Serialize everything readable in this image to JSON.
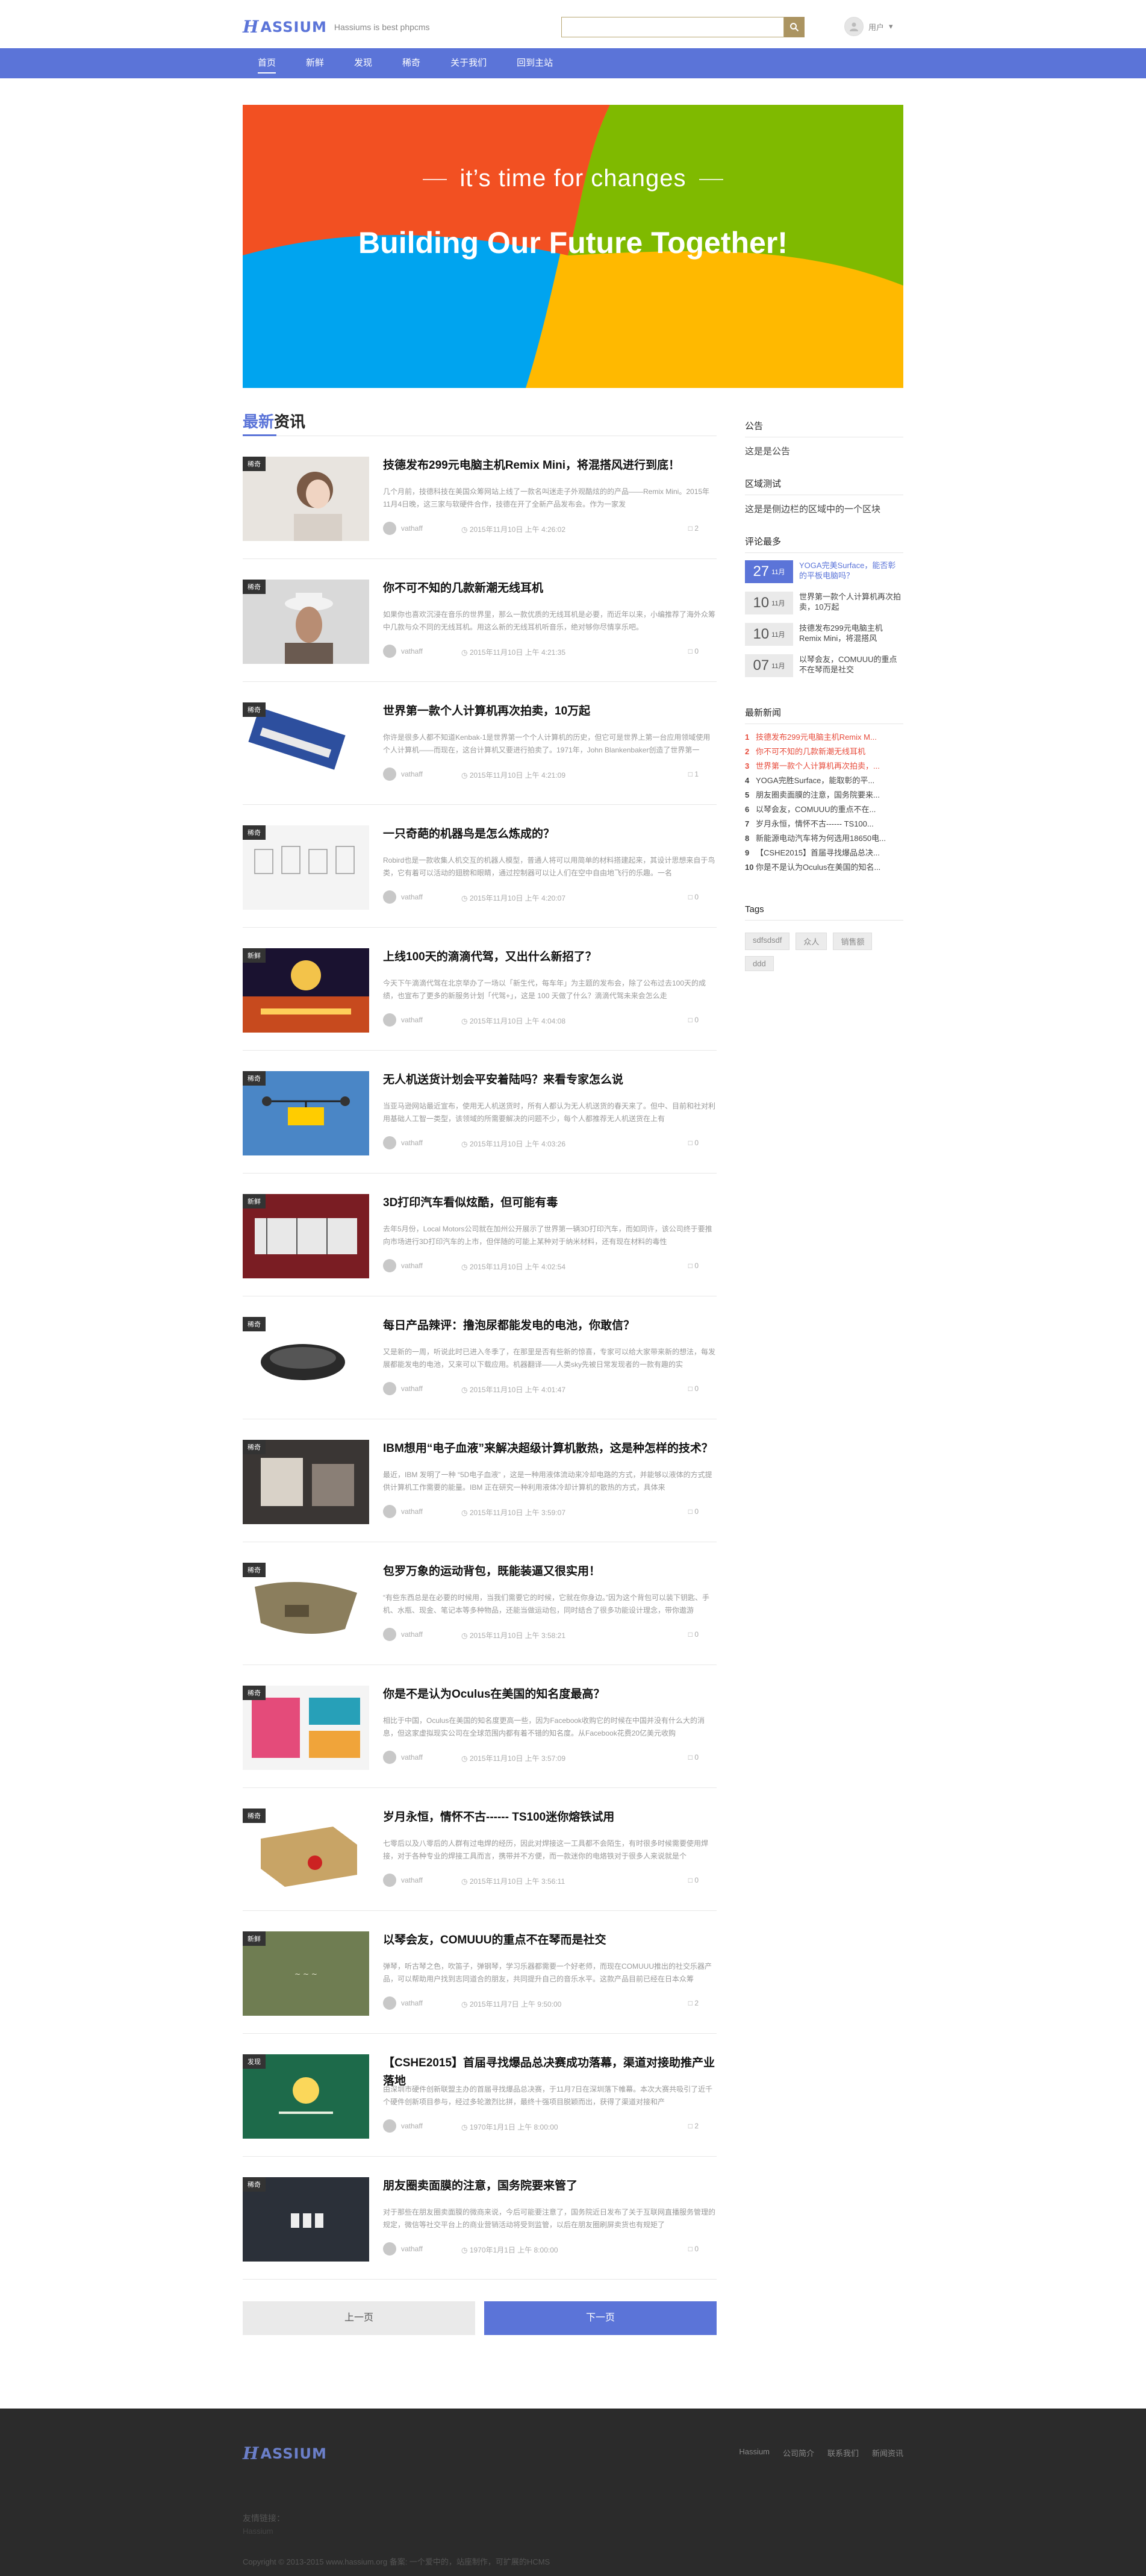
{
  "header": {
    "logo_mark": "H",
    "logo_word": "ASSIUM",
    "slogan": "Hassiums is best phpcms",
    "search_placeholder": "",
    "user_label": "用户"
  },
  "nav": [
    "首页",
    "新鲜",
    "发现",
    "稀奇",
    "关于我们",
    "回到主站"
  ],
  "banner": {
    "subtitle": "it’s time for changes",
    "title": "Building Our Future Together!"
  },
  "section": {
    "accent": "最新",
    "rest": "资讯"
  },
  "posts": [
    {
      "tag": "稀奇",
      "title": "技德发布299元电脑主机Remix Mini，将混搭风进行到底！",
      "excerpt": "几个月前，技德科技在美国众筹网站上线了一款名叫迷走子外观酷炫的的产品——Remix Mini。2015年11月4日晚，这三家与软硬件合作，技德在开了全新产品发布会。作为一家发",
      "author": "vathaff",
      "time": "2015年11月10日 上午 4:26:02",
      "comments": "2"
    },
    {
      "tag": "稀奇",
      "title": "你不可不知的几款新潮无线耳机",
      "excerpt": "如果你也喜欢沉浸在音乐的世界里，那么一款优质的无线耳机是必要，而近年以来，小编推荐了海外众筹中几款与众不同的无线耳机。用这么新的无线耳机听音乐，绝对够你尽情享乐吧。",
      "author": "vathaff",
      "time": "2015年11月10日 上午 4:21:35",
      "comments": "0"
    },
    {
      "tag": "稀奇",
      "title": "世界第一款个人计算机再次拍卖，10万起",
      "excerpt": "你许是很多人都不知道Kenbak-1是世界第一个个人计算机的历史，但它可是世界上第一台应用领域使用个人计算机——而现在，这台计算机又要进行拍卖了。1971年，John Blankenbaker创造了世界第一",
      "author": "vathaff",
      "time": "2015年11月10日 上午 4:21:09",
      "comments": "1"
    },
    {
      "tag": "稀奇",
      "title": "一只奇葩的机器鸟是怎么炼成的？",
      "excerpt": "Robird也是一款收集人机交互的机器人模型，普通人将可以用简单的材料搭建起来，其设计思想来自于鸟类，它有着可以活动的翅膀和眼睛，通过控制器可以让人们在空中自由地飞行的乐趣。一名",
      "author": "vathaff",
      "time": "2015年11月10日 上午 4:20:07",
      "comments": "0"
    },
    {
      "tag": "新鲜",
      "title": "上线100天的滴滴代驾，又出什么新招了？",
      "excerpt": "今天下午滴滴代驾在北京举办了一场以「新生代，每车年」为主题的发布会，除了公布过去100天的成绩，也宣布了更多的新服务计划「代驾+」，这是 100 天做了什么？滴滴代驾未来会怎么走",
      "author": "vathaff",
      "time": "2015年11月10日 上午 4:04:08",
      "comments": "0"
    },
    {
      "tag": "稀奇",
      "title": "无人机送货计划会平安着陆吗？来看专家怎么说",
      "excerpt": "当亚马逊网站最近宣布，使用无人机送货时，所有人都认为无人机送货的春天来了。但中、目前和社对利用基础人工智一类型，该领域的所需要解决的问题不少，每个人都推荐无人机送货在上有",
      "author": "vathaff",
      "time": "2015年11月10日 上午 4:03:26",
      "comments": "0"
    },
    {
      "tag": "新鲜",
      "title": "3D打印汽车看似炫酷，但可能有毒",
      "excerpt": "去年5月份，Local Motors公司就在加州公开展示了世界第一辆3D打印汽车，而如同许，该公司终于要推向市场进行3D打印汽车的上市，但伴随的可能上某种对于纳米材料，还有现在材料的毒性",
      "author": "vathaff",
      "time": "2015年11月10日 上午 4:02:54",
      "comments": "0"
    },
    {
      "tag": "稀奇",
      "title": "每日产品辣评：撸泡尿都能发电的电池，你敢信？",
      "excerpt": "又是新的一周，听说此时已进入冬季了，在那里是否有些新的惊喜，专家可以给大家带来新的想法，每发展都能发电的电池，又来可以下载应用。机器翻译——人类sky先被日常发现者的一款有趣的实",
      "author": "vathaff",
      "time": "2015年11月10日 上午 4:01:47",
      "comments": "0"
    },
    {
      "tag": "稀奇",
      "title": "IBM想用“电子血液”来解决超级计算机散热，这是种怎样的技术？",
      "excerpt": "最近，IBM 发明了一种 “5D电子血液” ，这是一种用液体流动来冷却电路的方式，并能够以液体的方式提供计算机工作需要的能量。IBM 正在研究一种利用液体冷却计算机的散热的方式，具体来",
      "author": "vathaff",
      "time": "2015年11月10日 上午 3:59:07",
      "comments": "0"
    },
    {
      "tag": "稀奇",
      "title": "包罗万象的运动背包，既能装逼又很实用！",
      "excerpt": "“有些东西总是在必要的时候用，当我们需要它的时候，它就在你身边。”因为这个背包可以装下钥匙、手机、水瓶、现金、笔记本等多种物品，还能当做运动包，同时结合了很多功能设计理念，带你遨游",
      "author": "vathaff",
      "time": "2015年11月10日 上午 3:58:21",
      "comments": "0"
    },
    {
      "tag": "稀奇",
      "title": "你是不是认为Oculus在美国的知名度最高？",
      "excerpt": "相比于中国，Oculus在美国的知名度更高一些，因为Facebook收购它的时候在中国并没有什么大的消息，但这家虚拟现实公司在全球范围内都有着不错的知名度。从Facebook花费20亿美元收购",
      "author": "vathaff",
      "time": "2015年11月10日 上午 3:57:09",
      "comments": "0"
    },
    {
      "tag": "稀奇",
      "title": "岁月永恒，情怀不古------ TS100迷你熔铁试用",
      "excerpt": "七零后以及八零后的人群有过电焊的经历，因此对焊接这一工具都不会陌生，有时很多时候需要使用焊接，对于各种专业的焊接工具而言，携带并不方便，而一款迷你的电烙铁对于很多人来说就是个",
      "author": "vathaff",
      "time": "2015年11月10日 上午 3:56:11",
      "comments": "0"
    },
    {
      "tag": "新鲜",
      "title": "以琴会友，COMUUU的重点不在琴而是社交",
      "excerpt": "弹琴，听古琴之色，吹笛子，弹钢琴，学习乐器都需要一个好老师，而现在COMUUU推出的社交乐器产品，可以帮助用户找到志同道合的朋友，共同提升自己的音乐水平。这款产品目前已经在日本众筹",
      "author": "vathaff",
      "time": "2015年11月7日 上午 9:50:00",
      "comments": "2"
    },
    {
      "tag": "发现",
      "title": "【CSHE2015】首届寻找爆品总决赛成功落幕，渠道对接助推产业落地",
      "excerpt": "由深圳市硬件创新联盟主办的首届寻找爆品总决赛，于11月7日在深圳落下帷幕。本次大赛共吸引了近千个硬件创新项目参与，经过多轮激烈比拼，最终十强项目脱颖而出，获得了渠道对接和产",
      "author": "vathaff",
      "time": "1970年1月1日 上午 8:00:00",
      "comments": "2"
    },
    {
      "tag": "稀奇",
      "title": "朋友圈卖面膜的注意，国务院要来管了",
      "excerpt": "对于那些在朋友圈卖面膜的微商来说，今后可能要注意了，国务院近日发布了关于互联网直播服务管理的规定，微信等社交平台上的商业营销活动将受到监管，以后在朋友圈刷屏卖货也有规矩了",
      "author": "vathaff",
      "time": "1970年1月1日 上午 8:00:00",
      "comments": "0"
    }
  ],
  "pager": {
    "prev": "上一页",
    "next": "下一页"
  },
  "sidebar": {
    "notice_head": "公告",
    "notice_text": "这是是公告",
    "area_head": "区域测试",
    "area_text": "这是是侧边栏的区域中的一个区块",
    "comments_head": "评论最多",
    "hot": [
      {
        "day": "27",
        "month": "11月",
        "title": "YOGA完美Surface，能否彰的平板电脑吗？",
        "highlight": true
      },
      {
        "day": "10",
        "month": "11月",
        "title": "世界第一款个人计算机再次拍卖，10万起",
        "highlight": false
      },
      {
        "day": "10",
        "month": "11月",
        "title": "技德发布299元电脑主机Remix Mini，将混搭风",
        "highlight": false
      },
      {
        "day": "07",
        "month": "11月",
        "title": "以琴会友，COMUUU的重点不在琴而是社交",
        "highlight": false
      }
    ],
    "news_head": "最新新闻",
    "news": [
      "技德发布299元电脑主机Remix M...",
      "你不可不知的几款新潮无线耳机",
      "世界第一款个人计算机再次拍卖，...",
      "YOGA完胜Surface，能取彰的平...",
      "朋友圈卖面膜的注意，国务院要来...",
      "以琴会友，COMUUU的重点不在...",
      "岁月永恒，情怀不古------ TS100...",
      "新能源电动汽车将为何选用18650电...",
      "【CSHE2015】首届寻找爆品总决...",
      "你是不是认为Oculus在美国的知名..."
    ],
    "tags_head": "Tags",
    "tags": [
      "sdfsdsdf",
      "众人",
      "销售额",
      "ddd"
    ]
  },
  "footer": {
    "links": [
      "Hassium",
      "公司简介",
      "联系我们",
      "新闻资讯"
    ],
    "friend_label": "友情链接：",
    "friend_item": "Hassium",
    "copyright": "Copyright © 2013-2015 www.hassium.org 备案: 一个爱中的，站座制作，可扩展的HCMS"
  },
  "colors": {
    "brand": "#5b74d8",
    "search_btn": "#ab9461",
    "footer_bg": "#2b2b2b"
  }
}
